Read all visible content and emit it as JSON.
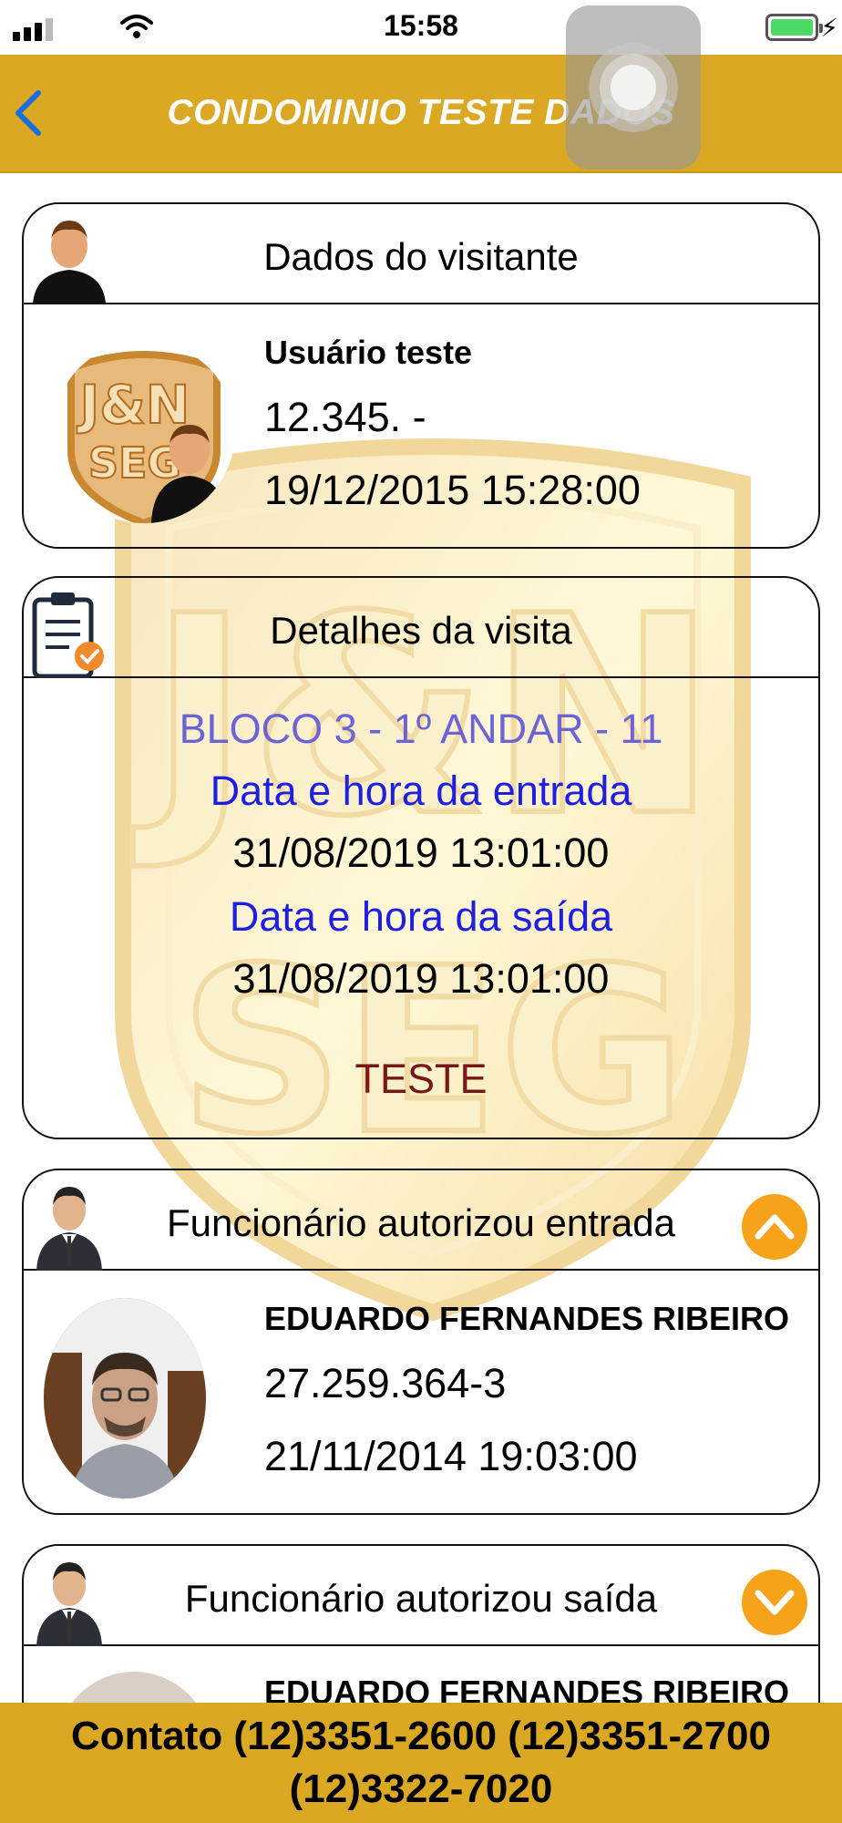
{
  "status_bar": {
    "time": "15:58"
  },
  "nav": {
    "title": "CONDOMINIO TESTE DADOS"
  },
  "visitor": {
    "header": "Dados do visitante",
    "name": "Usuário teste",
    "document": "12.345.   -",
    "datetime": "19/12/2015 15:28:00"
  },
  "visit": {
    "header": "Detalhes da visita",
    "location": "BLOCO 3 - 1º ANDAR - 11",
    "entry_label": "Data e hora da entrada",
    "entry_datetime": "31/08/2019 13:01:00",
    "exit_label": "Data e hora da saída",
    "exit_datetime": "31/08/2019 13:01:00",
    "note": "TESTE"
  },
  "entry_employee": {
    "header": "Funcionário autorizou entrada",
    "name": "EDUARDO FERNANDES RIBEIRO",
    "document": "27.259.364-3",
    "datetime": "21/11/2014 19:03:00"
  },
  "exit_employee": {
    "header": "Funcionário autorizou saída",
    "name": "EDUARDO FERNANDES RIBEIRO"
  },
  "footer": {
    "line1": "Contato (12)3351-2600 (12)3351-2700",
    "line2": "(12)3322-7020"
  },
  "colors": {
    "accent": "#dba823",
    "toggle": "#f7a21b",
    "back_arrow": "#1a6fe0",
    "label_blue": "#1f1fe0",
    "location_purple": "#6b63d6",
    "note_maroon": "#7a1616",
    "battery_green": "#4cd964"
  },
  "icons": {
    "back": "chevron-left-icon",
    "visitor": "person-icon",
    "visit": "clipboard-check-icon",
    "employee": "businessman-icon",
    "collapse": "chevron-up-icon",
    "expand": "chevron-down-icon"
  }
}
